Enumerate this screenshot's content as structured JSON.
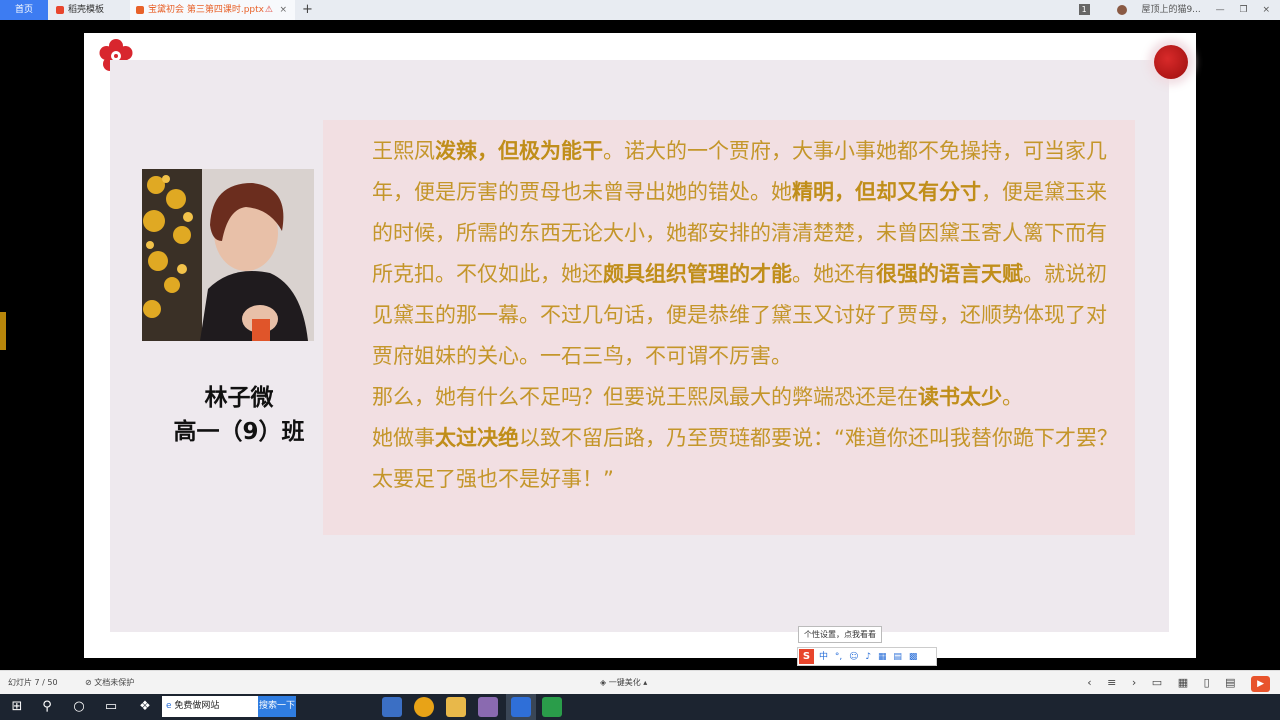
{
  "tabs": [
    {
      "label": "首页"
    },
    {
      "label": "稻壳模板"
    },
    {
      "label": "宝黛初会 第三第四课时.pptx"
    }
  ],
  "tab_add": "+",
  "tab_close": "×",
  "tab_warning": "⚠",
  "window": {
    "badge": "1",
    "user": "屋顶上的猫9...",
    "minimize": "—",
    "restore": "❐",
    "close": "×"
  },
  "author": {
    "name": "林子微",
    "class": "高一（9）班"
  },
  "essay": {
    "p1": [
      {
        "t": "王熙凤",
        "b": false
      },
      {
        "t": "泼辣，但极为能干",
        "b": true
      },
      {
        "t": "。诺大的一个贾府，大事小事她都不免操持，可当家几年，便是厉害的贾母也未曾寻出她的错处。她",
        "b": false
      },
      {
        "t": "精明，但却又有分寸",
        "b": true
      },
      {
        "t": "，便是黛玉来的时候，所需的东西无论大小，她都安排的清清楚楚，未曾因黛玉寄人篱下而有所克扣。不仅如此，她还",
        "b": false
      },
      {
        "t": "颇具组织管理的才能",
        "b": true
      },
      {
        "t": "。她还有",
        "b": false
      },
      {
        "t": "很强的语言天赋",
        "b": true
      },
      {
        "t": "。就说初见黛玉的那一幕。不过几句话，便是恭维了黛玉又讨好了贾母，还顺势体现了对贾府姐妹的关心。一石三鸟，不可谓不厉害。",
        "b": false
      }
    ],
    "p2": [
      {
        "t": "那么，她有什么不足吗？但要说王熙凤最大的弊端恐还是在",
        "b": false
      },
      {
        "t": "读书太少",
        "b": true
      },
      {
        "t": "。",
        "b": false
      }
    ],
    "p3": [
      {
        "t": "她做事",
        "b": false
      },
      {
        "t": "太过决绝",
        "b": true
      },
      {
        "t": "以致不留后路，乃至贾琏都要说：“难道你还叫我替你跪下才罢？太要足了强也不是好事！”",
        "b": false
      }
    ]
  },
  "ime": {
    "tooltip": "个性设置，点我看看",
    "logo": "S",
    "mode": "中"
  },
  "status": {
    "slide_count": "幻灯片 7 / 50",
    "protect": "文档未保护",
    "center": "一键美化"
  },
  "taskbar": {
    "search_value": "免费做网站",
    "search_button": "搜索一下"
  },
  "colors": {
    "accent_text": "#c4962a",
    "quote_bg": "#f2dfe2",
    "slide_bg": "#eee9ee",
    "seal": "#c01a1a",
    "tab_active": "#3d7cf2"
  }
}
